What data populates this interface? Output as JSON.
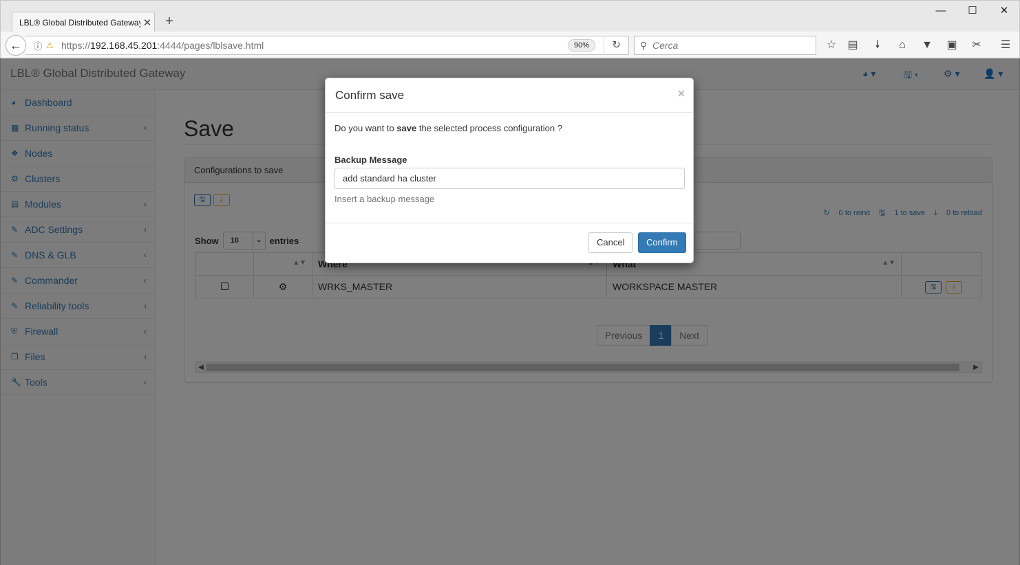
{
  "browser": {
    "tab_title": "LBL® Global Distributed Gateway",
    "tab_close": "✕",
    "new_tab": "+",
    "url_prefix": "https://",
    "url_host": "192.168.45.201",
    "url_rest": ":4444/pages/lblsave.html",
    "zoom": "90%",
    "search_placeholder": "Cerca"
  },
  "app": {
    "brand": "LBL® Global Distributed Gateway"
  },
  "sidebar": {
    "items": [
      {
        "label": "Dashboard",
        "icon": "dashboard-icon",
        "chevron": false
      },
      {
        "label": "Running status",
        "icon": "bar-chart-icon",
        "chevron": true
      },
      {
        "label": "Nodes",
        "icon": "cubes-icon",
        "chevron": false
      },
      {
        "label": "Clusters",
        "icon": "cogs-icon",
        "chevron": false
      },
      {
        "label": "Modules",
        "icon": "list-icon",
        "chevron": true
      },
      {
        "label": "ADC Settings",
        "icon": "edit-icon",
        "chevron": true
      },
      {
        "label": "DNS & GLB",
        "icon": "edit-icon",
        "chevron": true
      },
      {
        "label": "Commander",
        "icon": "edit-icon",
        "chevron": true
      },
      {
        "label": "Reliability tools",
        "icon": "edit-icon",
        "chevron": true
      },
      {
        "label": "Firewall",
        "icon": "shield-icon",
        "chevron": true
      },
      {
        "label": "Files",
        "icon": "files-icon",
        "chevron": true
      },
      {
        "label": "Tools",
        "icon": "wrench-icon",
        "chevron": true
      }
    ]
  },
  "main": {
    "page_title": "Save",
    "panel_heading": "Configurations to save",
    "counters": {
      "reinit": "0 to reinit",
      "save": "1 to save",
      "reload": "0 to reload"
    },
    "show_label": "Show",
    "entries_value": "10",
    "entries_label": "entries",
    "table": {
      "headers": [
        "",
        "",
        "Where",
        "What",
        ""
      ],
      "rows": [
        {
          "where": "WRKS_MASTER",
          "what": "WORKSPACE MASTER"
        }
      ]
    },
    "pagination": {
      "previous": "Previous",
      "current": "1",
      "next": "Next"
    }
  },
  "modal": {
    "title": "Confirm save",
    "close": "×",
    "question_pre": "Do you want to ",
    "question_bold": "save",
    "question_post": " the selected process configuration ?",
    "field_label": "Backup Message",
    "field_value": "add standard ha cluster",
    "help_text": "Insert a backup message",
    "cancel_label": "Cancel",
    "confirm_label": "Confirm"
  }
}
